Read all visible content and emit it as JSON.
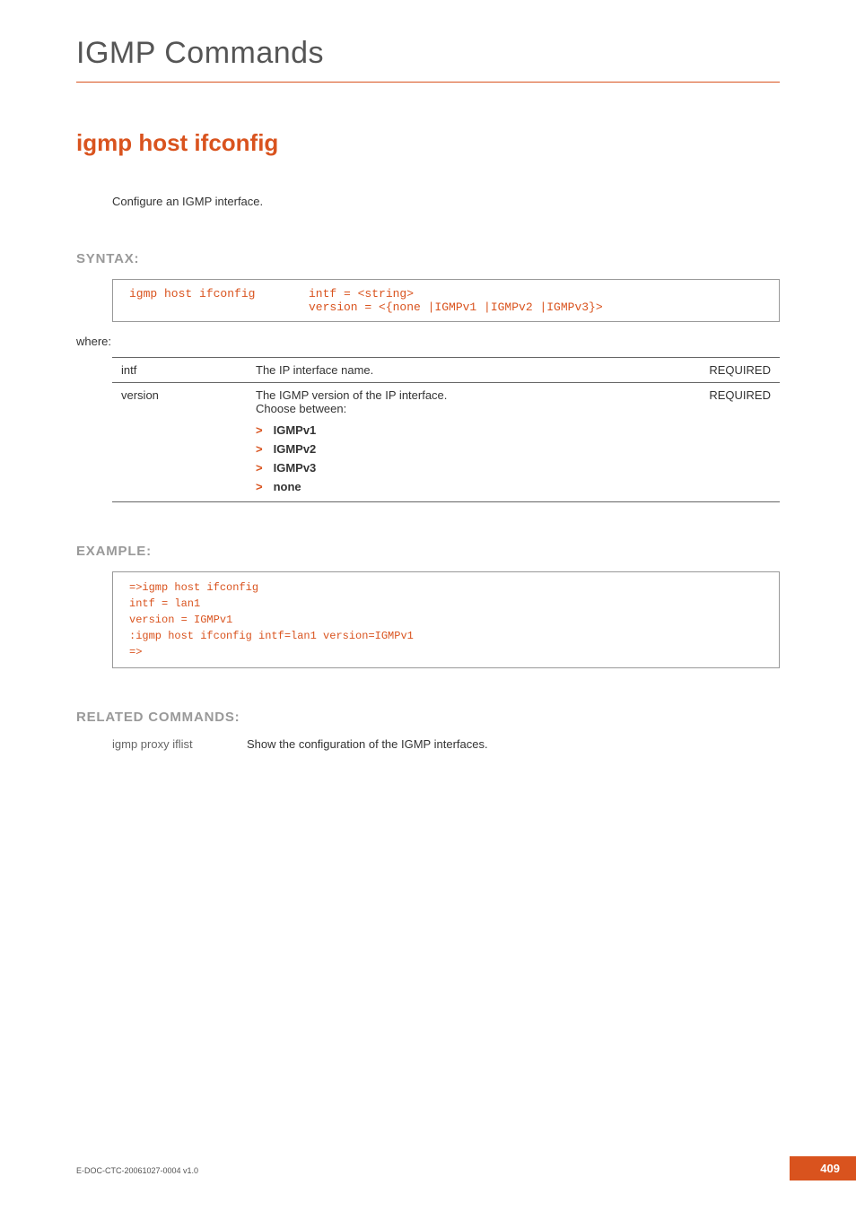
{
  "chapter_title": "IGMP Commands",
  "command_heading": "igmp host ifconfig",
  "description": "Configure an IGMP interface.",
  "syntax": {
    "label": "SYNTAX:",
    "cmd": "igmp host ifconfig",
    "args_line1": "intf = <string>",
    "args_line2": "version = <{none |IGMPv1 |IGMPv2 |IGMPv3}>",
    "where": "where:"
  },
  "params": [
    {
      "name": "intf",
      "desc": "The IP interface name.",
      "req": "REQUIRED",
      "options": []
    },
    {
      "name": "version",
      "desc": "The IGMP version of the IP interface.\nChoose between:",
      "req": "REQUIRED",
      "options": [
        "IGMPv1",
        "IGMPv2",
        "IGMPv3",
        "none"
      ]
    }
  ],
  "example": {
    "label": "EXAMPLE:",
    "text": "=>igmp host ifconfig\nintf = lan1\nversion = IGMPv1\n:igmp host ifconfig intf=lan1 version=IGMPv1\n=>"
  },
  "related": {
    "label": "RELATED COMMANDS:",
    "rows": [
      {
        "cmd": "igmp proxy iflist",
        "desc": "Show the configuration of the IGMP interfaces."
      }
    ]
  },
  "footer": {
    "doc_id": "E-DOC-CTC-20061027-0004 v1.0",
    "page": "409"
  }
}
